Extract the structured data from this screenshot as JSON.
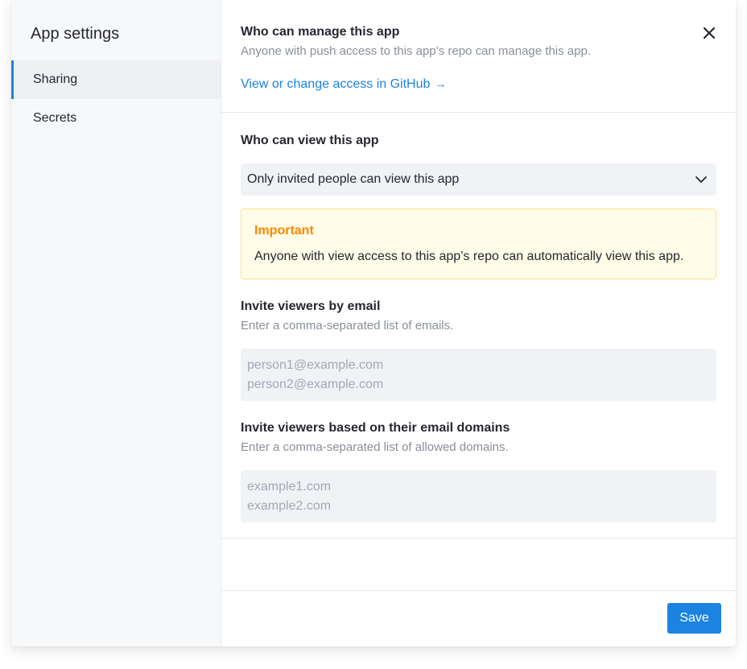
{
  "sidebar": {
    "title": "App settings",
    "items": [
      {
        "label": "Sharing",
        "active": true
      },
      {
        "label": "Secrets",
        "active": false
      }
    ]
  },
  "manage": {
    "title": "Who can manage this app",
    "description": "Anyone with push access to this app’s repo can manage this app.",
    "link_label": "View or change access in GitHub",
    "link_arrow": "→"
  },
  "view": {
    "title": "Who can view this app",
    "select_value": "Only invited people can view this app",
    "warning": {
      "title": "Important",
      "text": "Anyone with view access to this app’s repo can automatically view this app."
    },
    "invite_email": {
      "title": "Invite viewers by email",
      "description": "Enter a comma-separated list of emails.",
      "placeholder_lines": [
        "person1@example.com",
        "person2@example.com"
      ]
    },
    "invite_domain": {
      "title": "Invite viewers based on their email domains",
      "description": "Enter a comma-separated list of allowed domains.",
      "placeholder_lines": [
        "example1.com",
        "example2.com"
      ]
    }
  },
  "footer": {
    "save_label": "Save"
  },
  "icons": {
    "close": "close-icon",
    "chevron": "chevron-down-icon",
    "arrow": "arrow-right-icon"
  },
  "colors": {
    "accent": "#1c83e1",
    "warning_title": "#ff8700",
    "warning_bg": "#fffce7",
    "warning_border": "#ffe08a"
  }
}
